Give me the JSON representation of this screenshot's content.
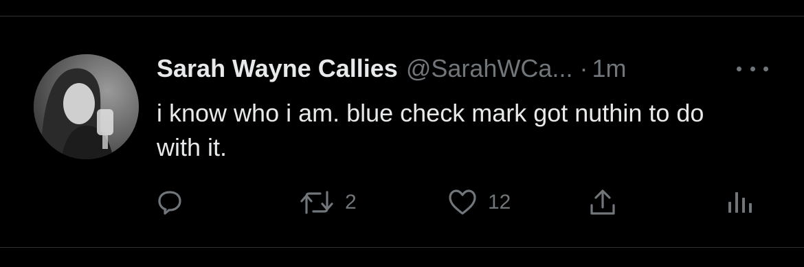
{
  "tweet": {
    "author_name": "Sarah Wayne Callies",
    "handle": "@SarahWCa...",
    "separator": "·",
    "time": "1m",
    "text": "i know who i am.  blue check mark got nuthin to do with it."
  },
  "actions": {
    "reply": {
      "icon": "reply-icon"
    },
    "retweet": {
      "icon": "retweet-icon",
      "count": "2"
    },
    "like": {
      "icon": "heart-icon",
      "count": "12"
    },
    "share": {
      "icon": "share-icon"
    },
    "analytics": {
      "icon": "analytics-icon"
    }
  },
  "colors": {
    "background": "#000000",
    "primary_text": "#e7e9ea",
    "secondary_text": "#71767b",
    "divider": "#2f3336"
  }
}
